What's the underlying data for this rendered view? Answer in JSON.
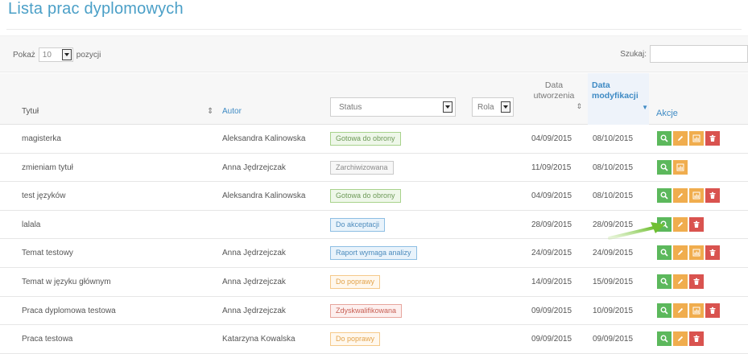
{
  "page": {
    "title": "Lista prac dyplomowych"
  },
  "controls": {
    "show_prefix": "Pokaż",
    "show_value": "10",
    "show_suffix": "pozycji",
    "search_label": "Szukaj:",
    "search_value": ""
  },
  "columns": {
    "title": "Tytuł",
    "author": "Autor",
    "status_filter": "Status",
    "role_filter": "Rola",
    "created_l1": "Data",
    "created_l2": "utworzenia",
    "modified_l1": "Data",
    "modified_l2": "modyfikacji",
    "actions": "Akcje"
  },
  "colors": {
    "accent": "#4a9fc7",
    "view": "#5cb85c",
    "edit": "#f0ad4e",
    "delete": "#d9534f",
    "arrow": "#7dc142"
  },
  "rows": [
    {
      "title": "magisterka",
      "author": "Aleksandra Kalinowska",
      "status": "Gotowa do obrony",
      "status_color": "green",
      "created": "04/09/2015",
      "modified": "08/10/2015",
      "actions": [
        "view-icon",
        "edit-icon",
        "stats-icon",
        "delete-icon"
      ]
    },
    {
      "title": "zmieniam tytuł",
      "author": "Anna Jędrzejczak",
      "status": "Zarchiwizowana",
      "status_color": "gray",
      "created": "11/09/2015",
      "modified": "08/10/2015",
      "actions": [
        "view-icon",
        "stats-icon"
      ]
    },
    {
      "title": "test języków",
      "author": "Aleksandra Kalinowska",
      "status": "Gotowa do obrony",
      "status_color": "green",
      "created": "04/09/2015",
      "modified": "08/10/2015",
      "actions": [
        "view-icon",
        "edit-icon",
        "stats-icon",
        "delete-icon"
      ]
    },
    {
      "title": "lalala",
      "author": "",
      "status": "Do akceptacji",
      "status_color": "blue",
      "created": "28/09/2015",
      "modified": "28/09/2015",
      "actions": [
        "view-icon",
        "edit-icon",
        "delete-icon"
      ]
    },
    {
      "title": "Temat testowy",
      "author": "Anna Jędrzejczak",
      "status": "Raport wymaga analizy",
      "status_color": "blue",
      "created": "24/09/2015",
      "modified": "24/09/2015",
      "actions": [
        "view-icon",
        "edit-icon",
        "stats-icon",
        "delete-icon"
      ]
    },
    {
      "title": "Temat w języku głównym",
      "author": "Anna Jędrzejczak",
      "status": "Do poprawy",
      "status_color": "orange",
      "created": "14/09/2015",
      "modified": "15/09/2015",
      "actions": [
        "view-icon",
        "edit-icon",
        "delete-icon"
      ]
    },
    {
      "title": "Praca dyplomowa testowa",
      "author": "Anna Jędrzejczak",
      "status": "Zdyskwalifikowana",
      "status_color": "red",
      "created": "09/09/2015",
      "modified": "10/09/2015",
      "actions": [
        "view-icon",
        "edit-icon",
        "stats-icon",
        "delete-icon"
      ]
    },
    {
      "title": "Praca testowa",
      "author": "Katarzyna Kowalska",
      "status": "Do poprawy",
      "status_color": "orange",
      "created": "09/09/2015",
      "modified": "09/09/2015",
      "actions": [
        "view-icon",
        "edit-icon",
        "delete-icon"
      ]
    }
  ]
}
